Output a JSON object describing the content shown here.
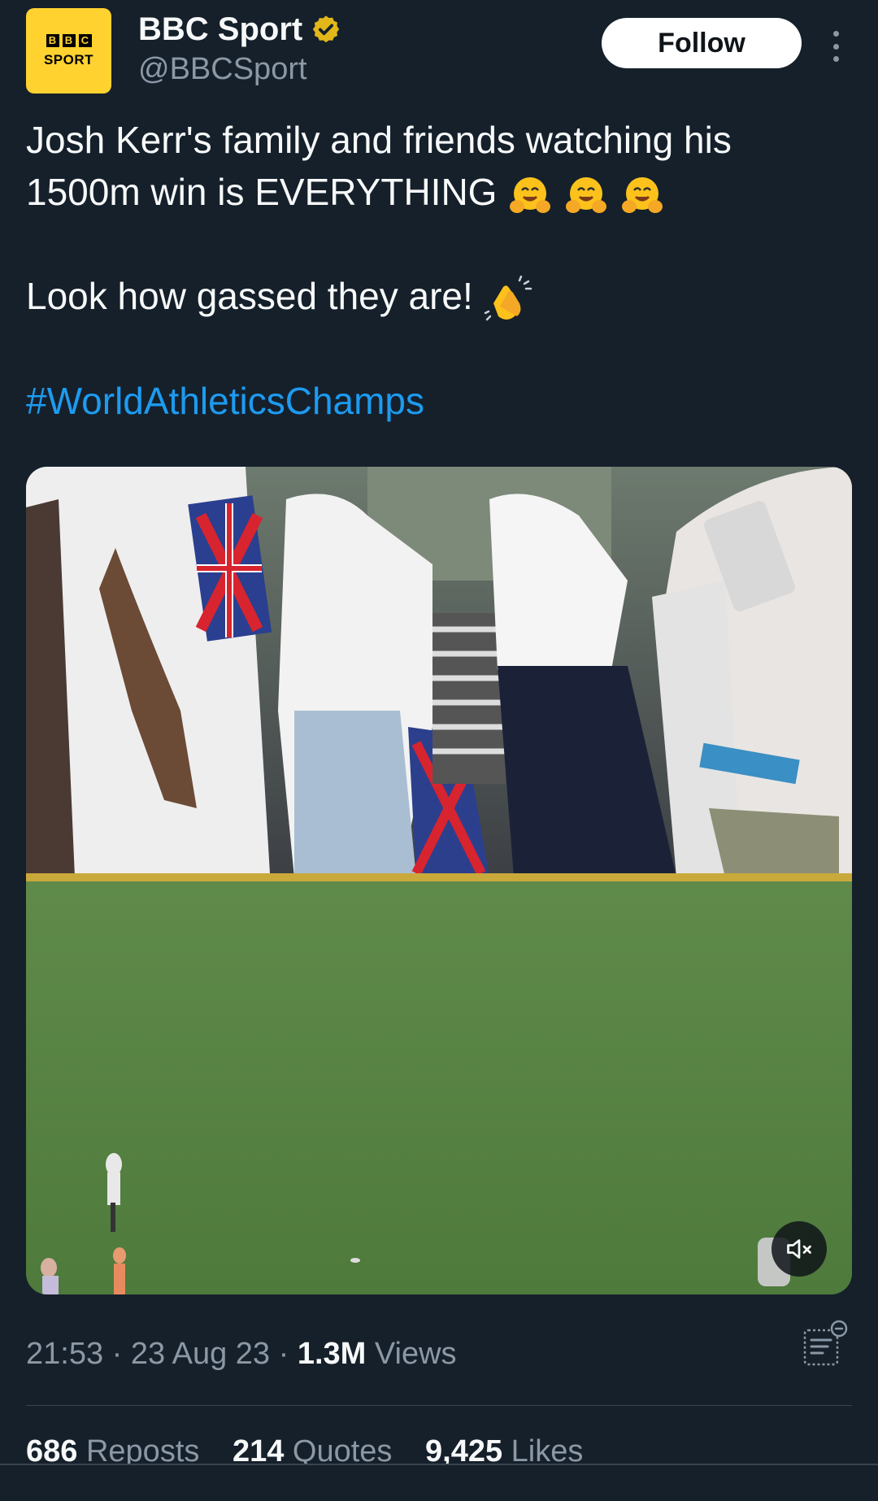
{
  "author": {
    "display_name": "BBC Sport",
    "handle": "@BBCSport",
    "avatar_blocks": [
      "B",
      "B",
      "C"
    ],
    "avatar_text": "SPORT",
    "verified_color": "#e2b719"
  },
  "follow_label": "Follow",
  "tweet": {
    "line1": "Josh Kerr's family and friends watching his",
    "line2": "1500m win is EVERYTHING",
    "line2_emojis": [
      "hugging-face-emoji",
      "hugging-face-emoji",
      "hugging-face-emoji"
    ],
    "line3": "Look how gassed they are!",
    "line3_emoji": "clapping-hands-emoji",
    "hashtag": "#WorldAthleticsChamps"
  },
  "media": {
    "type": "video",
    "description_icon": "muted-speaker-icon"
  },
  "meta": {
    "time": "21:53",
    "date": "23 Aug 23",
    "views_count": "1.3M",
    "views_label": "Views",
    "separator": "·"
  },
  "stats": {
    "reposts_count": "686",
    "reposts_label": "Reposts",
    "quotes_count": "214",
    "quotes_label": "Quotes",
    "likes_count": "9,425",
    "likes_label": "Likes"
  },
  "colors": {
    "background": "#15202b",
    "link": "#1d9bf0",
    "secondary_text": "#8b98a5",
    "avatar_bg": "#ffd230"
  }
}
